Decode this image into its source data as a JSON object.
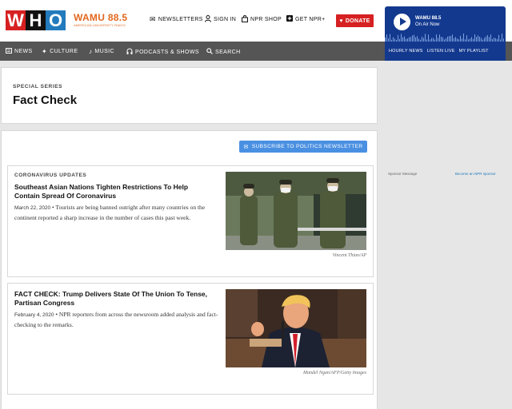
{
  "header": {
    "npr_letters": [
      "W",
      "H",
      "O"
    ],
    "station": {
      "name": "WAMU 88.5",
      "tagline": "AMERICAN UNIVERSITY RADIO"
    },
    "links": [
      {
        "icon": "envelope-icon",
        "label": "NEWSLETTERS"
      },
      {
        "icon": "user-icon",
        "label": "SIGN IN"
      },
      {
        "icon": "bag-icon",
        "label": "NPR SHOP"
      },
      {
        "icon": "plus-icon",
        "label": "GET NPR+"
      }
    ],
    "donate_label": "DONATE"
  },
  "player": {
    "station": "WAMU 88.5",
    "status": "On Air Now",
    "links": [
      "HOURLY NEWS",
      "LISTEN LIVE",
      "MY PLAYLIST"
    ]
  },
  "nav": [
    {
      "icon": "newspaper-icon",
      "label": "NEWS"
    },
    {
      "icon": "culture-icon",
      "label": "CULTURE"
    },
    {
      "icon": "music-note-icon",
      "label": "MUSIC"
    },
    {
      "icon": "headphones-icon",
      "label": "PODCASTS & SHOWS"
    },
    {
      "icon": "search-icon",
      "label": "SEARCH"
    }
  ],
  "series": {
    "label": "SPECIAL SERIES",
    "title": "Fact Check"
  },
  "subscribe_label": "SUBSCRIBE TO POLITICS NEWSLETTER",
  "stories": [
    {
      "slug": "CORONAVIRUS UPDATES",
      "title": "Southeast Asian Nations Tighten Restrictions To Help Contain Spread Of Coronavirus",
      "date": "March 22, 2020",
      "teaser": "Tourists are being banned outright after many countries on the continent reported a sharp increase in the number of cases this past week.",
      "credit": "Vincent Thian/AP"
    },
    {
      "slug": "",
      "title": "FACT CHECK: Trump Delivers State Of The Union To Tense, Partisan Congress",
      "date": "February 4, 2020",
      "teaser": "NPR reporters from across the newsroom added analysis and fact-checking to the remarks.",
      "credit": "Mandel Ngan/AFP/Getty Images"
    }
  ],
  "sponsor": {
    "label": "Sponsor Message",
    "link": "Become an NPR sponsor"
  },
  "colors": {
    "npr_red": "#d62021",
    "npr_blue": "#237bbd",
    "station_orange": "#e2671f",
    "player_blue": "#13398f",
    "nav_gray": "#555555",
    "subscribe_blue": "#4a90e2"
  }
}
